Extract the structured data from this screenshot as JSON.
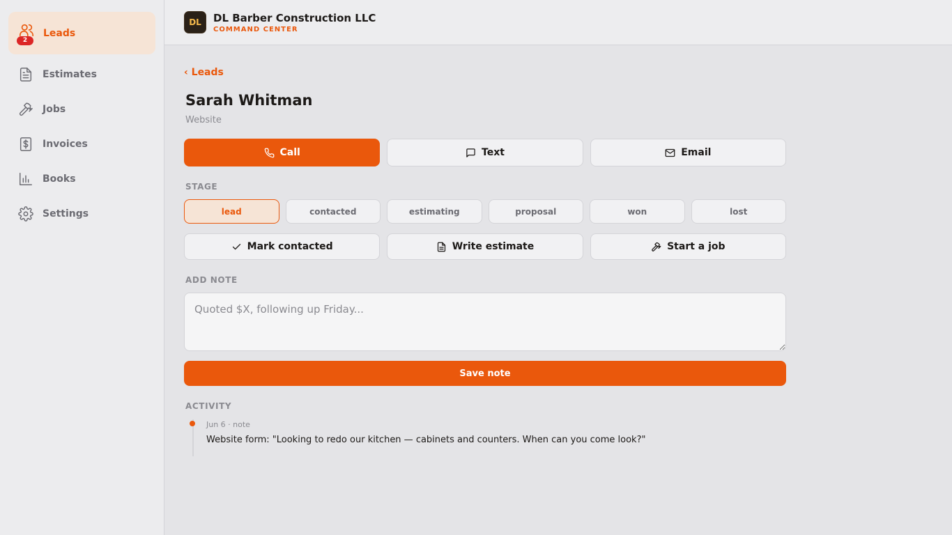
{
  "sidebar": {
    "items": [
      {
        "label": "Leads",
        "icon": "users-icon",
        "badge": "2",
        "active": true
      },
      {
        "label": "Estimates",
        "icon": "document-icon"
      },
      {
        "label": "Jobs",
        "icon": "hammer-icon"
      },
      {
        "label": "Invoices",
        "icon": "invoice-dollar-icon"
      },
      {
        "label": "Books",
        "icon": "bar-chart-icon"
      },
      {
        "label": "Settings",
        "icon": "gear-icon"
      }
    ]
  },
  "header": {
    "logo_text": "DL",
    "company_name": "DL Barber Construction LLC",
    "subtitle": "COMMAND CENTER"
  },
  "main": {
    "back_label": "‹ Leads",
    "lead_name": "Sarah Whitman",
    "lead_source": "Website",
    "contact_buttons": {
      "call": "Call",
      "text": "Text",
      "email": "Email"
    },
    "stage_label": "STAGE",
    "stages": [
      "lead",
      "contacted",
      "estimating",
      "proposal",
      "won",
      "lost"
    ],
    "current_stage": "lead",
    "actions": {
      "mark_contacted": "Mark contacted",
      "write_estimate": "Write estimate",
      "start_job": "Start a job"
    },
    "add_note_label": "ADD NOTE",
    "note_placeholder": "Quoted $X, following up Friday...",
    "save_note_label": "Save note",
    "activity_label": "ACTIVITY",
    "activity": [
      {
        "meta": "Jun 6 · note",
        "text": "Website form: \"Looking to redo our kitchen — cabinets and counters. When can you come look?\""
      }
    ]
  },
  "colors": {
    "accent": "#ea580c",
    "badge": "#dc2626",
    "background": "#e4e4e7"
  }
}
